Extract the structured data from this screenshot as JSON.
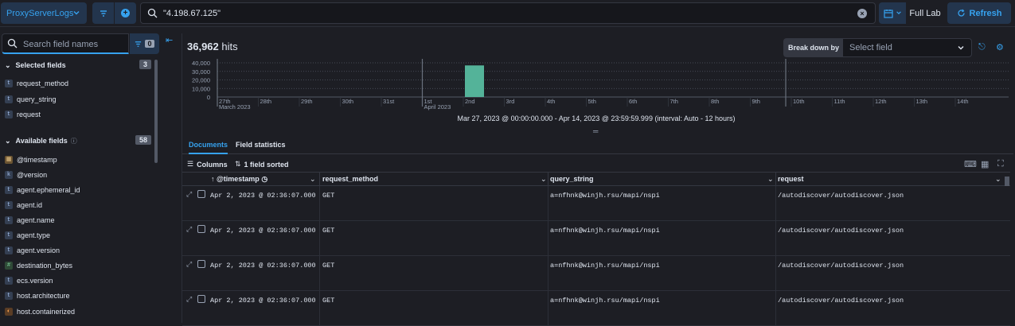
{
  "topbar": {
    "dataview_label": "ProxyServerLogs",
    "query_text": "\"4.198.67.125\"",
    "date_label": "Full Lab",
    "refresh_label": "Refresh",
    "accent": "#36a2ef"
  },
  "sidebar": {
    "search_placeholder": "Search field names",
    "filter_count": "0",
    "selected": {
      "title": "Selected fields",
      "count": "3",
      "fields": [
        {
          "type": "t",
          "name": "request_method"
        },
        {
          "type": "t",
          "name": "query_string"
        },
        {
          "type": "t",
          "name": "request"
        }
      ]
    },
    "available": {
      "title": "Available fields",
      "count": "58",
      "fields": [
        {
          "type": "date",
          "name": "@timestamp"
        },
        {
          "type": "k",
          "name": "@version"
        },
        {
          "type": "t",
          "name": "agent.ephemeral_id"
        },
        {
          "type": "t",
          "name": "agent.id"
        },
        {
          "type": "t",
          "name": "agent.name"
        },
        {
          "type": "t",
          "name": "agent.type"
        },
        {
          "type": "t",
          "name": "agent.version"
        },
        {
          "type": "num",
          "name": "destination_bytes"
        },
        {
          "type": "t",
          "name": "ecs.version"
        },
        {
          "type": "t",
          "name": "host.architecture"
        },
        {
          "type": "geo",
          "name": "host.containerized"
        }
      ]
    }
  },
  "main": {
    "hits_count": "36,962",
    "hits_label": "hits",
    "breakdown_label": "Break down by",
    "breakdown_placeholder": "Select field",
    "interval_text": "Mar 27, 2023 @ 00:00:00.000 - Apr 14, 2023 @ 23:59:59.999 (interval: Auto - 12 hours)",
    "tabs": [
      "Documents",
      "Field statistics"
    ],
    "columns_label": "Columns",
    "sorted_label": "1 field sorted"
  },
  "chart_data": {
    "type": "bar",
    "y_ticks": [
      "40,000",
      "30,000",
      "20,000",
      "10,000",
      "0"
    ],
    "ylim": [
      0,
      40000
    ],
    "x_ticks": [
      "27th",
      "28th",
      "29th",
      "30th",
      "31st",
      "1st",
      "2nd",
      "3rd",
      "4th",
      "5th",
      "6th",
      "7th",
      "8th",
      "9th",
      "10th",
      "11th",
      "12th",
      "13th",
      "14th"
    ],
    "x_sublabels": {
      "27th": "March 2023",
      "1st": "April 2023"
    },
    "bars": [
      {
        "x": "2nd",
        "value": 36962
      }
    ],
    "bar_color": "#54b399"
  },
  "grid": {
    "headers": [
      "@timestamp",
      "request_method",
      "query_string",
      "request"
    ],
    "rows": [
      [
        "Apr 2, 2023 @ 02:36:07.000",
        "GET",
        "a=nfhnk@winjh.rsu/mapi/nspi",
        "/autodiscover/autodiscover.json"
      ],
      [
        "Apr 2, 2023 @ 02:36:07.000",
        "GET",
        "a=nfhnk@winjh.rsu/mapi/nspi",
        "/autodiscover/autodiscover.json"
      ],
      [
        "Apr 2, 2023 @ 02:36:07.000",
        "GET",
        "a=nfhnk@winjh.rsu/mapi/nspi",
        "/autodiscover/autodiscover.json"
      ],
      [
        "Apr 2, 2023 @ 02:36:07.000",
        "GET",
        "a=nfhnk@winjh.rsu/mapi/nspi",
        "/autodiscover/autodiscover.json"
      ]
    ]
  }
}
